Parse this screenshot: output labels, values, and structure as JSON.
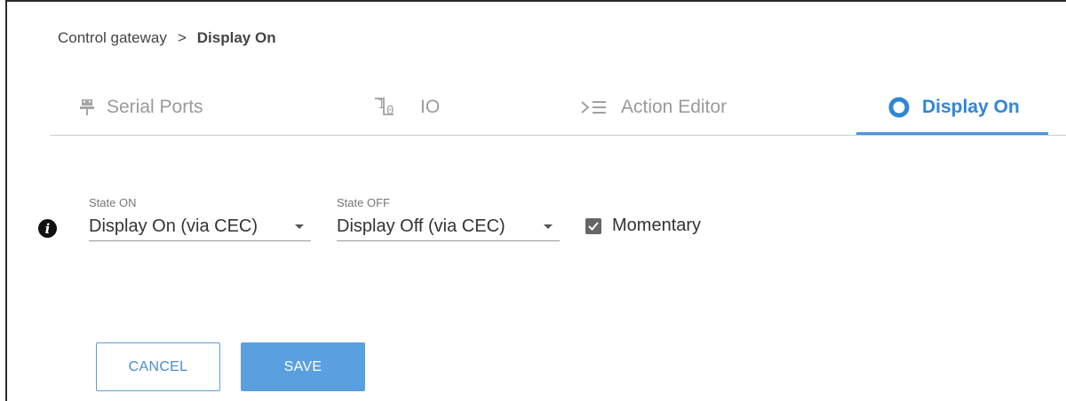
{
  "breadcrumb": {
    "parent": "Control gateway",
    "separator": ">",
    "current": "Display On"
  },
  "tabs": [
    {
      "label": "Serial Ports",
      "icon": "serial-port-icon",
      "active": false
    },
    {
      "label": "IO",
      "icon": "io-icon",
      "active": false
    },
    {
      "label": "Action Editor",
      "icon": "action-editor-icon",
      "active": false
    },
    {
      "label": "Display On",
      "icon": "display-on-circle-icon",
      "active": true
    }
  ],
  "form": {
    "state_on": {
      "label": "State ON",
      "value": "Display On (via CEC)"
    },
    "state_off": {
      "label": "State OFF",
      "value": "Display Off (via CEC)"
    },
    "momentary": {
      "label": "Momentary",
      "checked": true
    }
  },
  "buttons": {
    "cancel": "CANCEL",
    "save": "SAVE"
  },
  "colors": {
    "accent": "#2f86d6",
    "save_bg": "#5aa0e0",
    "inactive_tab": "#9a9a9a"
  }
}
